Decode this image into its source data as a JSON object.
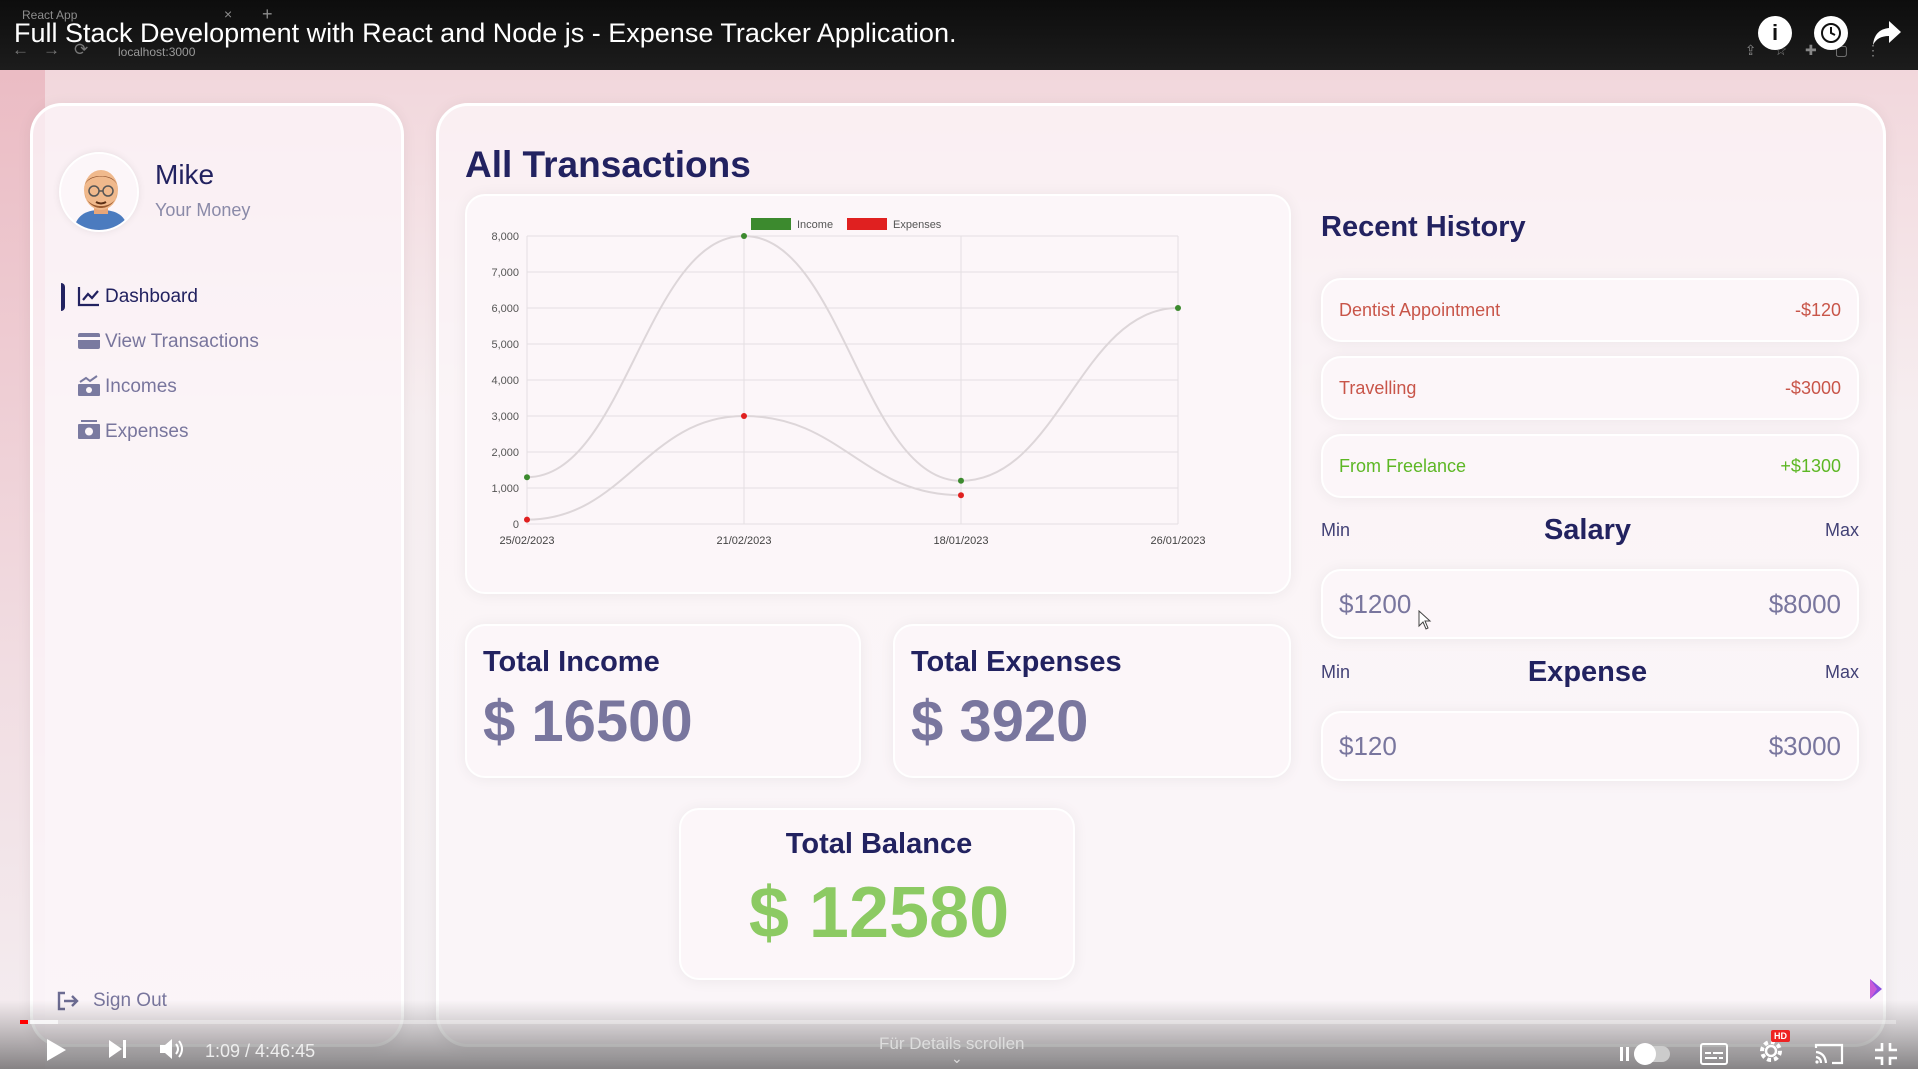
{
  "browser": {
    "tab_title": "React App",
    "url": "localhost:3000"
  },
  "video": {
    "title": "Full Stack Development with React and Node js - Expense Tracker Application.",
    "time": "1:09 / 4:46:45",
    "scroll_hint": "Für Details scrollen",
    "progress_fraction": 0.004
  },
  "user": {
    "name": "Mike",
    "subtitle": "Your Money"
  },
  "menu": {
    "items": [
      {
        "label": "Dashboard",
        "icon": "line-chart-icon",
        "active": true
      },
      {
        "label": "View Transactions",
        "icon": "credit-card-icon",
        "active": false
      },
      {
        "label": "Incomes",
        "icon": "money-bill-trend-icon",
        "active": false
      },
      {
        "label": "Expenses",
        "icon": "money-bill-icon",
        "active": false
      }
    ],
    "signout": "Sign Out"
  },
  "main": {
    "title": "All Transactions",
    "total_income_label": "Total Income",
    "total_income_value": "$ 16500",
    "total_expenses_label": "Total Expenses",
    "total_expenses_value": "$ 3920",
    "total_balance_label": "Total Balance",
    "total_balance_value": "$ 12580"
  },
  "history": {
    "title": "Recent History",
    "items": [
      {
        "title": "Dentist Appointment",
        "amount": "-$120",
        "type": "expense"
      },
      {
        "title": "Travelling",
        "amount": "-$3000",
        "type": "expense"
      },
      {
        "title": "From Freelance",
        "amount": "+$1300",
        "type": "income"
      }
    ]
  },
  "ranges": {
    "min_label": "Min",
    "max_label": "Max",
    "salary": {
      "title": "Salary",
      "min": "$1200",
      "max": "$8000"
    },
    "expense": {
      "title": "Expense",
      "min": "$120",
      "max": "$3000"
    }
  },
  "colors": {
    "primary": "#222260",
    "income": "#3c8a2e",
    "expense": "#e02020",
    "balance_green": "#42ad00"
  },
  "chart_data": {
    "type": "line",
    "categories": [
      "25/02/2023",
      "21/02/2023",
      "18/01/2023",
      "26/01/2023"
    ],
    "series": [
      {
        "name": "Income",
        "values": [
          1300,
          8000,
          1200,
          6000
        ],
        "color": "#3c8a2e"
      },
      {
        "name": "Expenses",
        "values": [
          120,
          3000,
          800,
          null
        ],
        "color": "#e02020"
      }
    ],
    "ylim": [
      0,
      8000
    ],
    "yticks": [
      "0",
      "1,000",
      "2,000",
      "3,000",
      "4,000",
      "5,000",
      "6,000",
      "7,000",
      "8,000"
    ],
    "legend": "top",
    "grid": true
  }
}
